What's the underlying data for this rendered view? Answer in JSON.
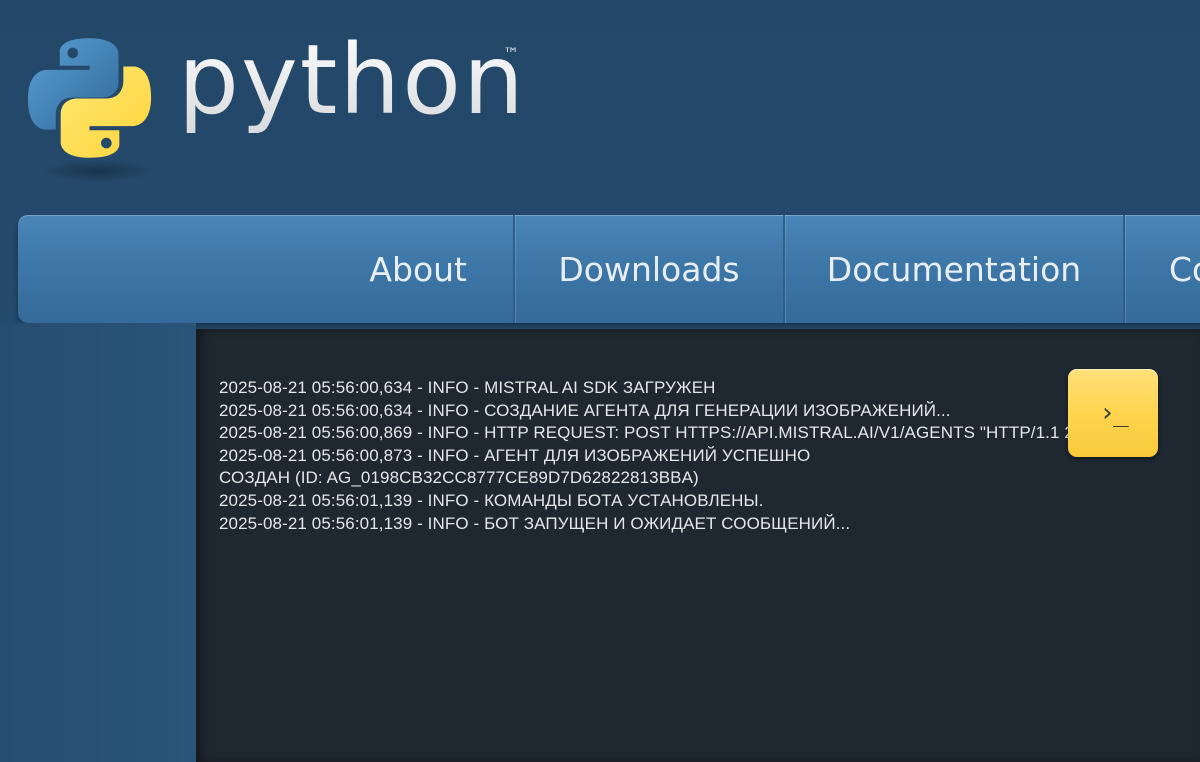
{
  "header": {
    "brand": "python",
    "trademark": "™"
  },
  "nav": {
    "items": [
      {
        "label": "About"
      },
      {
        "label": "Downloads"
      },
      {
        "label": "Documentation"
      },
      {
        "label": "Co"
      }
    ]
  },
  "terminal": {
    "prompt_icon": "›_",
    "log_lines": [
      "2025-08-21 05:56:00,634 - INFO - MISTRAL AI SDK ЗАГРУЖЕН",
      "2025-08-21 05:56:00,634 - INFO - СОЗДАНИЕ АГЕНТА ДЛЯ ГЕНЕРАЦИИ ИЗОБРАЖЕНИЙ...",
      "2025-08-21 05:56:00,869 - INFO - HTTP REQUEST: POST HTTPS://API.MISTRAL.AI/V1/AGENTS \"HTTP/1.1 200 OK\"",
      "2025-08-21 05:56:00,873 - INFO - АГЕНТ ДЛЯ ИЗОБРАЖЕНИЙ УСПЕШНО СОЗДАН (ID: AG_0198CB32CC8777CE89D7D62822813BBA)",
      "2025-08-21 05:56:01,139 - INFO - КОМАНДЫ БОТА УСТАНОВЛЕНЫ.",
      "2025-08-21 05:56:01,139 - INFO - БОТ ЗАПУЩЕН И ОЖИДАЕТ СООБЩЕНИЙ..."
    ]
  },
  "colors": {
    "background": "#244a6a",
    "nav": "#3d77a8",
    "terminal": "#1f2731",
    "accent_yellow": "#ffd54f",
    "logo_blue": "#3b73a3",
    "logo_yellow": "#ffd43b"
  },
  "icons": {
    "logo": "python-logo-icon",
    "prompt": "terminal-prompt-icon"
  }
}
